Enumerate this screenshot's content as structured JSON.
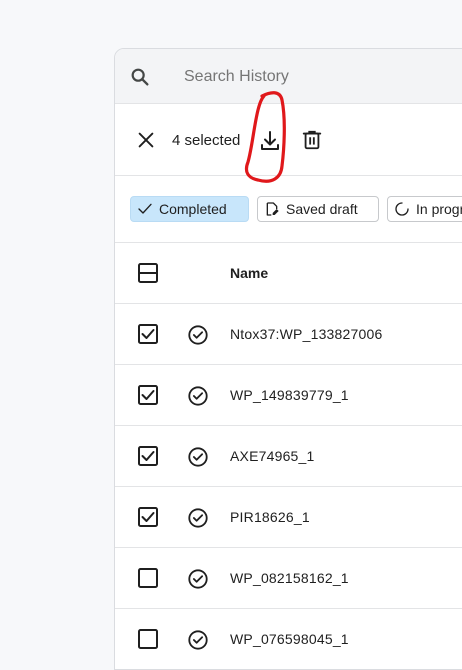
{
  "search": {
    "placeholder": "Search History",
    "icon": "search-icon"
  },
  "toolbar": {
    "selected_text": "4 selected",
    "close_icon": "close-icon",
    "download_icon": "download-icon",
    "delete_icon": "trash-icon"
  },
  "filters": [
    {
      "label": "Completed",
      "active": true,
      "icon": "check-icon"
    },
    {
      "label": "Saved draft",
      "active": false,
      "icon": "draft-icon"
    },
    {
      "label": "In progress",
      "active": false,
      "icon": "loading-icon"
    }
  ],
  "table": {
    "header": {
      "name": "Name"
    },
    "rows": [
      {
        "name": "Ntox37:WP_133827006",
        "checked": true
      },
      {
        "name": "WP_149839779_1",
        "checked": true
      },
      {
        "name": "AXE74965_1",
        "checked": true
      },
      {
        "name": "PIR18626_1",
        "checked": true
      },
      {
        "name": "WP_082158162_1",
        "checked": false
      },
      {
        "name": "WP_076598045_1",
        "checked": false
      }
    ]
  },
  "colors": {
    "accent_chip_bg": "#c8e6fb",
    "annotation": "#e0181b",
    "text": "#1f1f1f"
  }
}
